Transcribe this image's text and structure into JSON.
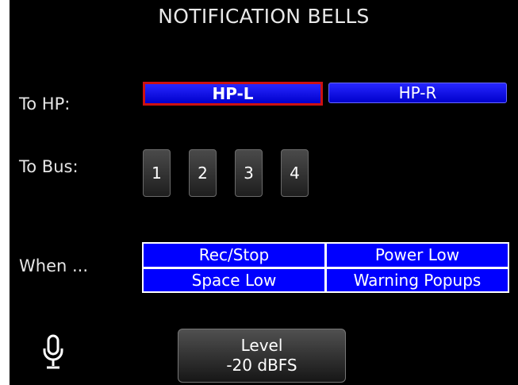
{
  "title": "NOTIFICATION BELLS",
  "to_hp": {
    "label": "To HP:",
    "options": [
      {
        "label": "HP-L",
        "selected": true
      },
      {
        "label": "HP-R",
        "selected": false
      }
    ]
  },
  "to_bus": {
    "label": "To Bus:",
    "buttons": [
      "1",
      "2",
      "3",
      "4"
    ]
  },
  "when": {
    "label": "When ...",
    "options": [
      "Rec/Stop",
      "Power Low",
      "Space Low",
      "Warning Popups"
    ]
  },
  "level": {
    "title": "Level",
    "value": "-20 dBFS"
  },
  "icons": {
    "mic": "microphone-icon"
  },
  "colors": {
    "background": "#000000",
    "selected_blue": "#0000ff",
    "selection_border": "#cc1111",
    "button_gray": "#3a3a3a"
  }
}
